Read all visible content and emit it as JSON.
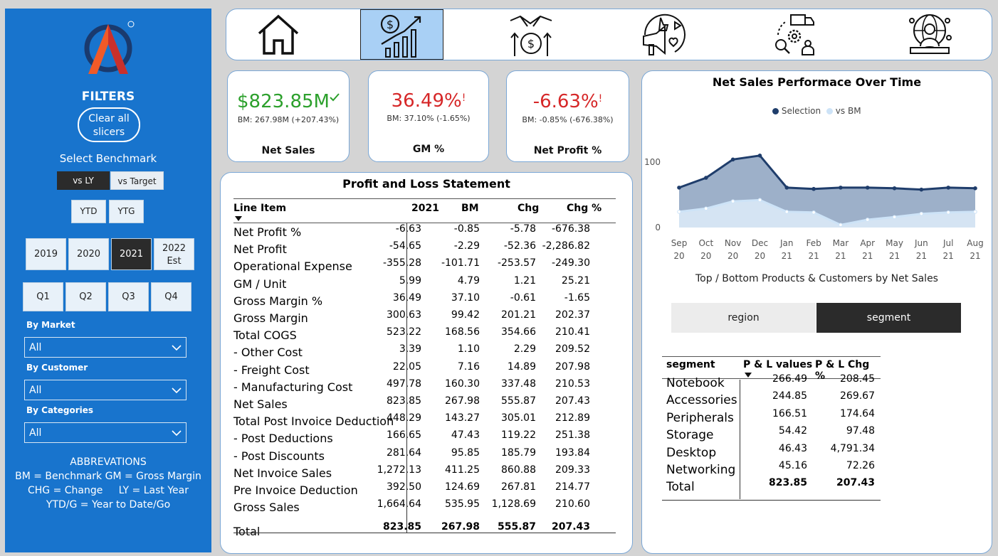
{
  "sidebar": {
    "filters_title": "FILTERS",
    "clear_button": "Clear all slicers",
    "benchmark_title": "Select Benchmark",
    "benchmark_options": [
      "vs LY",
      "vs Target"
    ],
    "benchmark_selected": "vs LY",
    "period_options": [
      "YTD",
      "YTG"
    ],
    "years": [
      "2019",
      "2020",
      "2021",
      "2022 Est"
    ],
    "year_selected": "2021",
    "quarters": [
      "Q1",
      "Q2",
      "Q3",
      "Q4"
    ],
    "filters": [
      {
        "label": "By Market",
        "value": "All"
      },
      {
        "label": "By Customer",
        "value": "All"
      },
      {
        "label": "By Categories",
        "value": "All"
      }
    ],
    "abbreviations": {
      "title": "ABBREVATIONS",
      "line1": "BM = Benchmark GM = Gross Margin",
      "line2": "CHG = Change     LY = Last Year",
      "line3": "YTD/G = Year to Date/Go"
    }
  },
  "nav": {
    "items": [
      "home-icon",
      "finance-growth-icon",
      "sales-handshake-icon",
      "marketing-icon",
      "supply-chain-icon",
      "executive-icon"
    ],
    "selected_index": 1
  },
  "kpis": [
    {
      "name": "Net Sales",
      "value": "$823.85M",
      "sub": "BM: 267.98M (+207.43%)",
      "status": "good",
      "status_color": "#2ca02c"
    },
    {
      "name": "GM %",
      "value": "36.49%",
      "sub": "BM: 37.10% (-1.65%)",
      "status": "bad",
      "status_color": "#d62728"
    },
    {
      "name": "Net Profit %",
      "value": "-6.63%",
      "sub": "BM: -0.85% (-676.38%)",
      "status": "bad",
      "status_color": "#d62728"
    }
  ],
  "pl": {
    "title": "Profit and Loss Statement",
    "headers": [
      "Line Item",
      "2021",
      "BM",
      "Chg",
      "Chg %"
    ],
    "rows": [
      [
        "Net Profit %",
        "-6.63",
        "-0.85",
        "-5.78",
        "-676.38"
      ],
      [
        "Net Profit",
        "-54.65",
        "-2.29",
        "-52.36",
        "-2,286.82"
      ],
      [
        "Operational Expense",
        "-355.28",
        "-101.71",
        "-253.57",
        "-249.30"
      ],
      [
        "GM / Unit",
        "5.99",
        "4.79",
        "1.21",
        "25.21"
      ],
      [
        "Gross Margin %",
        "36.49",
        "37.10",
        "-0.61",
        "-1.65"
      ],
      [
        "Gross Margin",
        "300.63",
        "99.42",
        "201.21",
        "202.37"
      ],
      [
        "Total COGS",
        "523.22",
        "168.56",
        "354.66",
        "210.41"
      ],
      [
        "- Other Cost",
        "3.39",
        "1.10",
        "2.29",
        "209.52"
      ],
      [
        "- Freight Cost",
        "22.05",
        "7.16",
        "14.89",
        "207.98"
      ],
      [
        "- Manufacturing Cost",
        "497.78",
        "160.30",
        "337.48",
        "210.53"
      ],
      [
        "Net Sales",
        "823.85",
        "267.98",
        "555.87",
        "207.43"
      ],
      [
        "Total Post Invoice Deduction",
        "448.29",
        "143.27",
        "305.01",
        "212.89"
      ],
      [
        "- Post Deductions",
        "166.65",
        "47.43",
        "119.22",
        "251.38"
      ],
      [
        "- Post Discounts",
        "281.64",
        "95.85",
        "185.79",
        "193.84"
      ],
      [
        "Net Invoice Sales",
        "1,272.13",
        "411.25",
        "860.88",
        "209.33"
      ],
      [
        "Pre Invoice Deduction",
        "392.50",
        "124.69",
        "267.81",
        "214.77"
      ],
      [
        "Gross Sales",
        "1,664.64",
        "535.95",
        "1,128.69",
        "210.60"
      ]
    ],
    "total": [
      "Total",
      "823.85",
      "267.98",
      "555.87",
      "207.43"
    ]
  },
  "right_panel": {
    "chart_title": "Net Sales Performace Over Time",
    "legend": [
      {
        "name": "Selection",
        "color": "#1f3d6b"
      },
      {
        "name": "vs BM",
        "color": "#cde3f7"
      }
    ],
    "subtitle": "Top / Bottom Products & Customers by Net Sales",
    "toggles": [
      "region",
      "segment"
    ],
    "toggle_selected": "segment",
    "segment_table": {
      "headers": [
        "segment",
        "P & L values",
        "P & L Chg %"
      ],
      "rows": [
        [
          "Notebook",
          "266.49",
          "208.45"
        ],
        [
          "Accessories",
          "244.85",
          "269.67"
        ],
        [
          "Peripherals",
          "166.51",
          "174.64"
        ],
        [
          "Storage",
          "54.42",
          "97.48"
        ],
        [
          "Desktop",
          "46.43",
          "4,791.34"
        ],
        [
          "Networking",
          "45.16",
          "72.26"
        ]
      ],
      "total": [
        "Total",
        "823.85",
        "207.43"
      ]
    }
  },
  "chart_data": {
    "type": "area",
    "title": "Net Sales Performace Over Time",
    "x": [
      [
        "Sep",
        "20"
      ],
      [
        "Oct",
        "20"
      ],
      [
        "Nov",
        "20"
      ],
      [
        "Dec",
        "20"
      ],
      [
        "Jan",
        "21"
      ],
      [
        "Feb",
        "21"
      ],
      [
        "Mar",
        "21"
      ],
      [
        "Apr",
        "21"
      ],
      [
        "May",
        "21"
      ],
      [
        "Jun",
        "21"
      ],
      [
        "Jul",
        "21"
      ],
      [
        "Aug",
        "21"
      ]
    ],
    "yticks": [
      "100",
      "0"
    ],
    "ylim": [
      0,
      140
    ],
    "series": [
      {
        "name": "Selection",
        "values": [
          61,
          76,
          104,
          110,
          61,
          59,
          61,
          61,
          60,
          58,
          61,
          60
        ],
        "color": "#1f3d6b",
        "fill": "#9db0c9"
      },
      {
        "name": "vs BM",
        "values": [
          24,
          29,
          40,
          42,
          24,
          23,
          4,
          12,
          16,
          21,
          23,
          24
        ],
        "color": "#cde3f7",
        "fill": "#dceaf7"
      }
    ],
    "grid": false,
    "legend_position": "top"
  }
}
